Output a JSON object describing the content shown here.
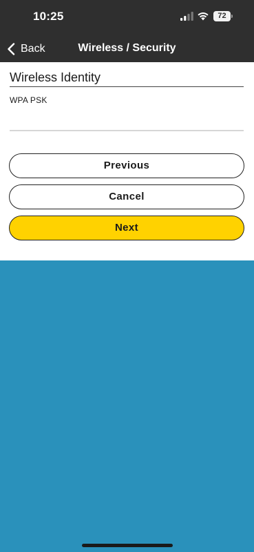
{
  "status_bar": {
    "time": "10:25",
    "battery_level": "72",
    "signal_strength": 0.5,
    "icons": [
      "signal-icon",
      "wifi-icon",
      "battery-icon"
    ]
  },
  "nav": {
    "back_label": "Back",
    "title": "Wireless / Security",
    "back_icon": "chevron-left-icon"
  },
  "form": {
    "section_title": "Wireless Identity",
    "field_label": "WPA PSK",
    "psk_value": ""
  },
  "buttons": {
    "previous": "Previous",
    "cancel": "Cancel",
    "next": "Next"
  },
  "colors": {
    "header_bg": "#2f2f2f",
    "accent_yellow": "#ffd200",
    "background_blue": "#2a91bb",
    "content_bg": "#ffffff"
  }
}
